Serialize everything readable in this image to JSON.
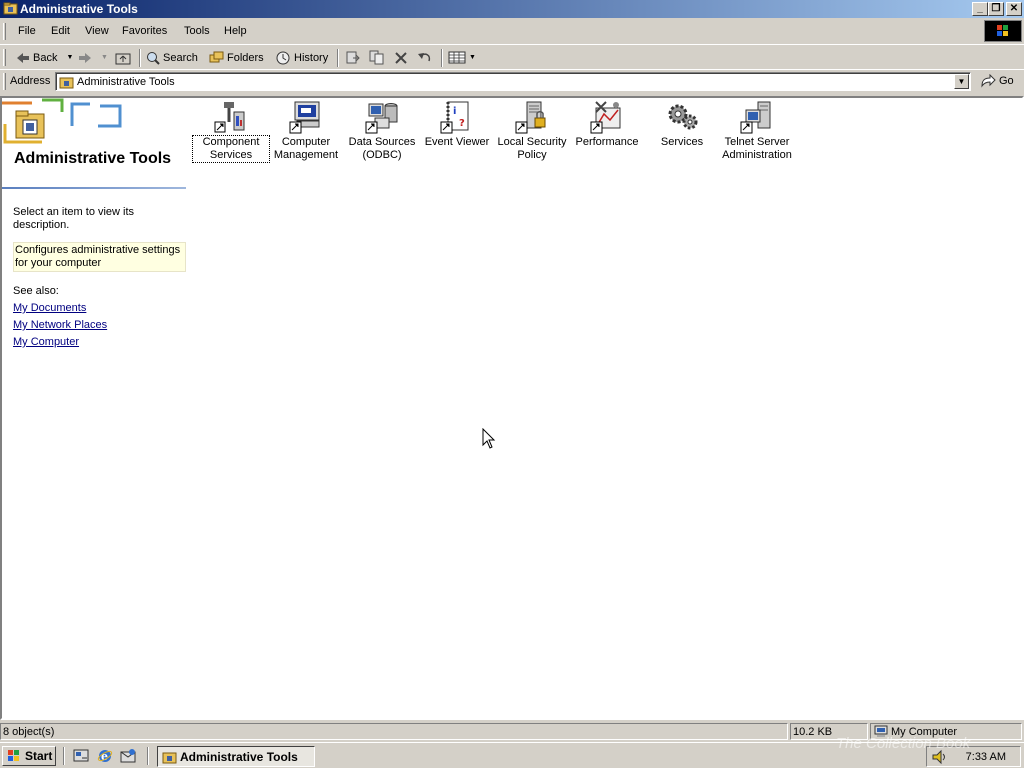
{
  "window": {
    "title": "Administrative Tools"
  },
  "menu": [
    "File",
    "Edit",
    "View",
    "Favorites",
    "Tools",
    "Help"
  ],
  "toolbar": {
    "back": "Back",
    "search": "Search",
    "folders": "Folders",
    "history": "History"
  },
  "address": {
    "label": "Address",
    "value": "Administrative Tools",
    "go": "Go"
  },
  "left_pane": {
    "title": "Administrative Tools",
    "prompt": "Select an item to view its description.",
    "description": "Configures administrative settings for your computer",
    "see_also": "See also:",
    "links": [
      "My Documents",
      "My Network Places",
      "My Computer"
    ]
  },
  "icons": [
    {
      "label": "Component Services",
      "icon": "component-services-icon"
    },
    {
      "label": "Computer Management",
      "icon": "computer-management-icon"
    },
    {
      "label": "Data Sources (ODBC)",
      "icon": "data-sources-icon"
    },
    {
      "label": "Event Viewer",
      "icon": "event-viewer-icon"
    },
    {
      "label": "Local Security Policy",
      "icon": "local-security-policy-icon"
    },
    {
      "label": "Performance",
      "icon": "performance-icon"
    },
    {
      "label": "Services",
      "icon": "services-icon"
    },
    {
      "label": "Telnet Server Administration",
      "icon": "telnet-server-icon"
    }
  ],
  "status": {
    "objects": "8 object(s)",
    "size": "10.2 KB",
    "zone": "My Computer"
  },
  "taskbar": {
    "start": "Start",
    "task": "Administrative Tools",
    "clock": "7:33 AM"
  },
  "watermark": "The Collection Book",
  "colors": {
    "title_start": "#0a246a",
    "title_end": "#a6caf0",
    "link": "#000080",
    "face": "#d4d0c8"
  }
}
